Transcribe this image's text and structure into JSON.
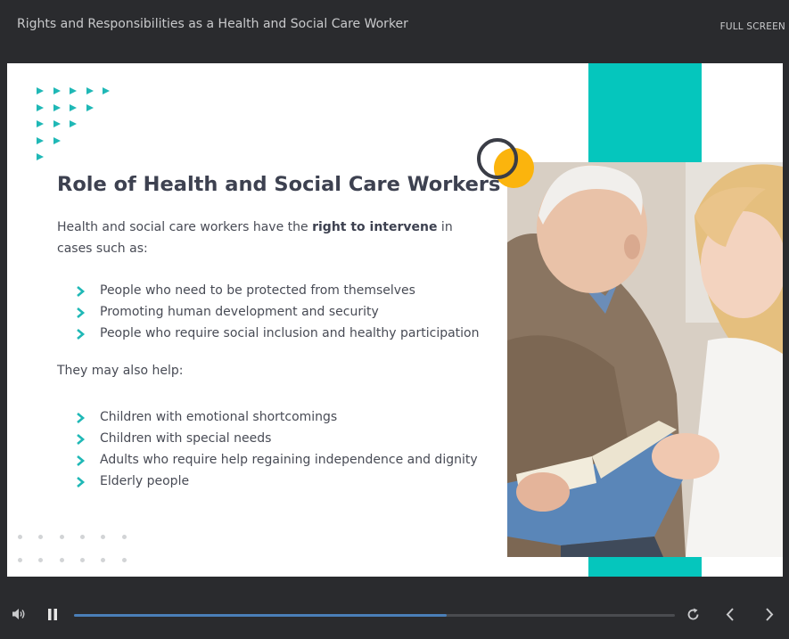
{
  "header": {
    "title": "Rights and Responsibilities as a Health and Social Care Worker",
    "fullscreen_label": "FULL SCREEN"
  },
  "slide": {
    "heading": "Role of Health and Social Care Workers",
    "intro_before": "Health and social care workers have the ",
    "intro_bold": "right to intervene",
    "intro_after": " in cases such as:",
    "list1": [
      "People who need to be protected from themselves",
      "Promoting human development and security",
      "People who require social inclusion and healthy participation"
    ],
    "subheading": "They may also help:",
    "list2": [
      "Children with emotional shortcomings",
      "Children with special needs",
      "Adults who require help regaining independence and dignity",
      "Elderly people"
    ]
  },
  "colors": {
    "accent_teal": "#05c6bd",
    "triangle_teal": "#1fb8b6",
    "accent_yellow": "#fbb40d",
    "progress": "#4a7fb8"
  },
  "player": {
    "progress_fraction": 0.62,
    "icons": [
      "volume-icon",
      "pause-icon",
      "replay-icon",
      "prev-icon",
      "next-icon"
    ]
  }
}
